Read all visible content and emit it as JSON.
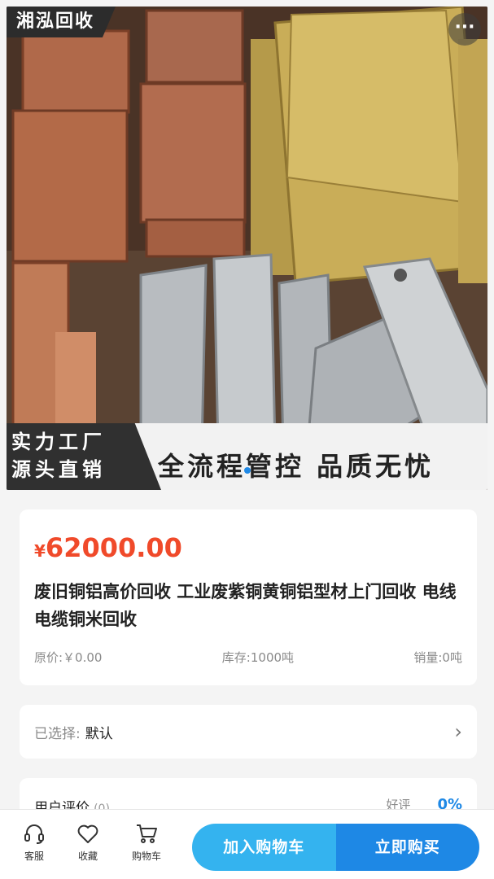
{
  "hero": {
    "brand": "湘泓回收",
    "more": "···",
    "banner_left_line1": "实力工厂",
    "banner_left_line2": "源头直销",
    "banner_right": "全流程管控  品质无忧"
  },
  "product": {
    "currency": "¥",
    "price": "62000.00",
    "title": "废旧铜铝高价回收 工业废紫铜黄铜铝型材上门回收 电线电缆铜米回收",
    "original_price": "原价:￥0.00",
    "stock": "库存:1000吨",
    "sales": "销量:0吨"
  },
  "selection": {
    "label": "已选择:",
    "value": "默认"
  },
  "reviews": {
    "label": "用户评价",
    "count": "(0)",
    "good_label": "好评",
    "good_rate": "0%"
  },
  "bottom_bar": {
    "service": "客服",
    "favorite": "收藏",
    "cart": "购物车",
    "add_to_cart": "加入购物车",
    "buy_now": "立即购买"
  },
  "colors": {
    "price": "#f04a2a",
    "accent": "#1e88e5",
    "cart_button": "#34b3ef"
  }
}
